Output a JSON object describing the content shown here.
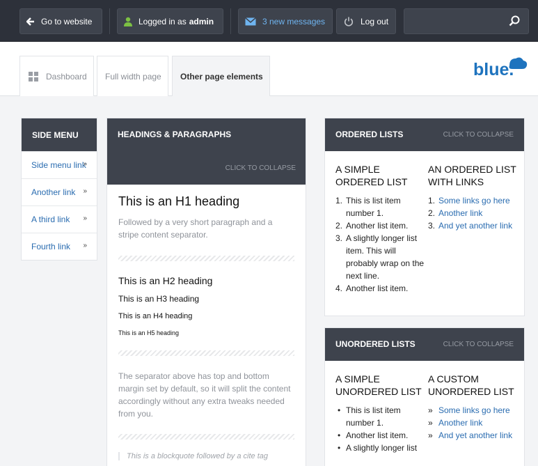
{
  "topbar": {
    "go_to_website": "Go to website",
    "logged_in_prefix": "Logged in as",
    "logged_in_user": "admin",
    "messages": "3 new messages",
    "logout": "Log out",
    "search_placeholder": ""
  },
  "tabs": [
    {
      "label": "Dashboard"
    },
    {
      "label": "Full width page"
    },
    {
      "label": "Other page elements"
    }
  ],
  "logo": {
    "text": "blue."
  },
  "side_menu": {
    "title": "SIDE MENU",
    "items": [
      "Side menu link",
      "Another link",
      "A third link",
      "Fourth link"
    ]
  },
  "headings_panel": {
    "title": "HEADINGS & PARAGRAPHS",
    "collapse": "CLICK TO COLLAPSE",
    "h1": "This is an H1 heading",
    "p1": "Followed by a very short paragraph and a stripe content separator.",
    "h2": "This is an H2 heading",
    "h3": "This is an H3 heading",
    "h4": "This is an H4 heading",
    "h5": "This is an H5 heading",
    "p2": "The separator above has top and bottom margin set by default, so it will split the content accordingly without any extra tweaks needed from you.",
    "quote": "This is a blockquote followed by a cite tag"
  },
  "ordered_panel": {
    "title": "ORDERED LISTS",
    "collapse": "CLICK TO COLLAPSE",
    "col1_title": "A SIMPLE ORDERED LIST",
    "col1_items": [
      "This is list item number 1.",
      "Another list item.",
      "A slightly longer list item. This will probably wrap on the next line.",
      "Another list item."
    ],
    "col2_title": "AN ORDERED LIST WITH LINKS",
    "col2_items": [
      "Some links go here",
      "Another link",
      "And yet another link"
    ]
  },
  "unordered_panel": {
    "title": "UNORDERED LISTS",
    "collapse": "CLICK TO COLLAPSE",
    "col1_title": "A SIMPLE UNORDERED LIST",
    "col1_items": [
      "This is list item number 1.",
      "Another list item.",
      "A slightly longer list"
    ],
    "col2_title": "A CUSTOM UNORDERED LIST",
    "col2_items": [
      "Some links go here",
      "Another link",
      "And yet another link"
    ]
  },
  "colors": {
    "dark": "#2d313a",
    "panel_head": "#3e434d",
    "link": "#2a6cb0",
    "logo": "#1e73be"
  }
}
